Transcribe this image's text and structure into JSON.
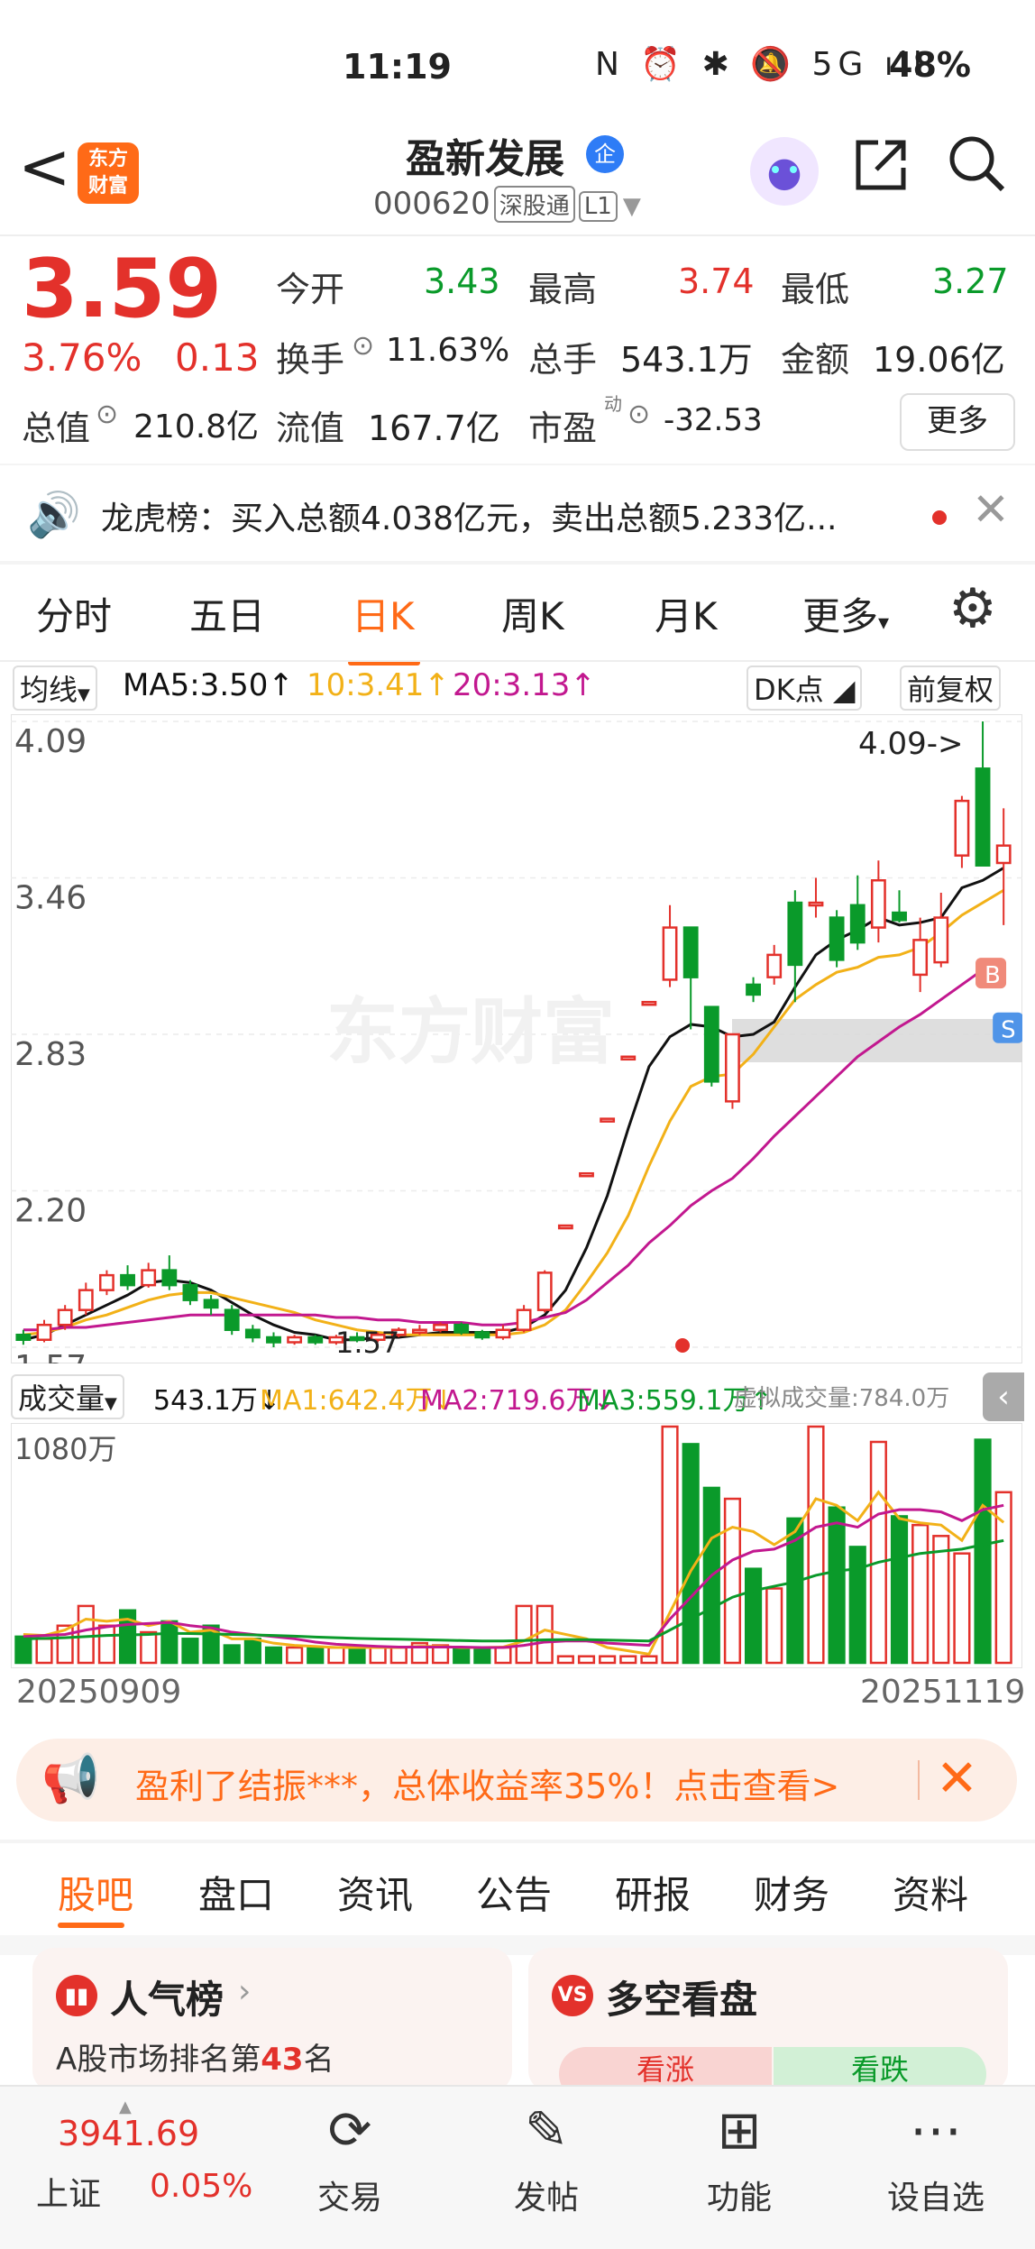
{
  "status_bar": {
    "time": "11:19",
    "icons": "N ⏰ ✱ 🔕 5G ıll",
    "battery": "48%"
  },
  "header": {
    "back": "<",
    "logo_line1": "东方",
    "logo_line2": "财富",
    "title": "盈新发展",
    "badge": "企",
    "code": "000620",
    "tag1": "深股通",
    "tag2": "L1"
  },
  "quote": {
    "price": "3.59",
    "change_pct": "3.76%",
    "change": "0.13",
    "open_label": "今开",
    "open": "3.43",
    "high_label": "最高",
    "high": "3.74",
    "low_label": "最低",
    "low": "3.27",
    "turnover_label": "换手",
    "turnover": "11.63%",
    "volume_label": "总手",
    "volume": "543.1万",
    "amount_label": "金额",
    "amount": "19.06亿",
    "mktcap_label": "总值",
    "mktcap": "210.8亿",
    "float_label": "流值",
    "float": "167.7亿",
    "pe_label": "市盈",
    "pe_sup": "动",
    "pe": "-32.53",
    "more": "更多"
  },
  "news": {
    "text": "龙虎榜：买入总额4.038亿元，卖出总额5.233亿..."
  },
  "tabs": [
    "分时",
    "五日",
    "日K",
    "周K",
    "月K",
    "更多"
  ],
  "tabs_more_arrow": "▾",
  "chart_header": {
    "ma_select": "均线",
    "ma5": "MA5:3.50↑",
    "ma10": "10:3.41↑",
    "ma20": "20:3.13↑",
    "dk": "DK点",
    "fq": "前复权"
  },
  "vol_header": {
    "select": "成交量",
    "vol": "543.1万↓",
    "ma1": "MA1:642.4万↓",
    "ma2": "MA2:719.6万↓",
    "ma3": "MA3:559.1万↑",
    "virtual": "虚拟成交量:784.0万"
  },
  "chart_labels": {
    "y1": "4.09",
    "y2": "3.46",
    "y3": "2.83",
    "y4": "2.20",
    "y5": "1.57",
    "max_label": "4.09->",
    "min_label": "1.57",
    "vol_max": "1080万",
    "date_start": "20250909",
    "date_end": "20251119",
    "watermark": "东方财富",
    "b": "B",
    "s": "S"
  },
  "chart_data": {
    "type": "candlestick",
    "ylim": [
      1.57,
      4.09
    ],
    "candles": [
      [
        1.62,
        1.6,
        1.64,
        1.58
      ],
      [
        1.6,
        1.66,
        1.68,
        1.59
      ],
      [
        1.66,
        1.72,
        1.74,
        1.64
      ],
      [
        1.72,
        1.8,
        1.83,
        1.7
      ],
      [
        1.8,
        1.86,
        1.88,
        1.78
      ],
      [
        1.86,
        1.82,
        1.9,
        1.8
      ],
      [
        1.82,
        1.88,
        1.91,
        1.81
      ],
      [
        1.88,
        1.82,
        1.94,
        1.8
      ],
      [
        1.82,
        1.76,
        1.84,
        1.74
      ],
      [
        1.76,
        1.73,
        1.78,
        1.7
      ],
      [
        1.72,
        1.64,
        1.74,
        1.62
      ],
      [
        1.64,
        1.61,
        1.66,
        1.59
      ],
      [
        1.61,
        1.59,
        1.63,
        1.57
      ],
      [
        1.59,
        1.61,
        1.62,
        1.58
      ],
      [
        1.61,
        1.59,
        1.62,
        1.58
      ],
      [
        1.59,
        1.61,
        1.62,
        1.58
      ],
      [
        1.61,
        1.6,
        1.63,
        1.59
      ],
      [
        1.6,
        1.62,
        1.63,
        1.59
      ],
      [
        1.62,
        1.64,
        1.65,
        1.61
      ],
      [
        1.64,
        1.64,
        1.66,
        1.62
      ],
      [
        1.64,
        1.66,
        1.67,
        1.63
      ],
      [
        1.66,
        1.63,
        1.67,
        1.62
      ],
      [
        1.63,
        1.61,
        1.64,
        1.6
      ],
      [
        1.61,
        1.64,
        1.66,
        1.6
      ],
      [
        1.64,
        1.72,
        1.74,
        1.63
      ],
      [
        1.72,
        1.87,
        1.88,
        1.71
      ],
      [
        2.06,
        2.06,
        2.06,
        2.06
      ],
      [
        2.27,
        2.27,
        2.27,
        2.27
      ],
      [
        2.49,
        2.49,
        2.49,
        2.49
      ],
      [
        2.74,
        2.74,
        2.74,
        2.74
      ],
      [
        2.96,
        2.96,
        2.96,
        2.96
      ],
      [
        3.05,
        3.26,
        3.35,
        3.02
      ],
      [
        3.26,
        3.06,
        3.21,
        2.85
      ],
      [
        2.94,
        2.64,
        2.9,
        2.62
      ],
      [
        2.56,
        2.83,
        2.83,
        2.53
      ],
      [
        3.03,
        2.99,
        3.06,
        2.96
      ],
      [
        3.06,
        3.15,
        3.19,
        3.03
      ],
      [
        3.36,
        3.11,
        3.41,
        2.96
      ],
      [
        3.36,
        3.36,
        3.46,
        3.3
      ],
      [
        3.3,
        3.13,
        3.33,
        3.1
      ],
      [
        3.35,
        3.2,
        3.47,
        3.17
      ],
      [
        3.26,
        3.45,
        3.53,
        3.2
      ],
      [
        3.32,
        3.29,
        3.41,
        3.28
      ],
      [
        3.07,
        3.21,
        3.3,
        3.0
      ],
      [
        3.12,
        3.3,
        3.4,
        3.1
      ],
      [
        3.55,
        3.77,
        3.79,
        3.5
      ],
      [
        3.9,
        3.51,
        4.09,
        3.52
      ],
      [
        3.52,
        3.59,
        3.74,
        3.27
      ]
    ],
    "ma5": [
      1.6,
      1.62,
      1.66,
      1.7,
      1.74,
      1.78,
      1.83,
      1.84,
      1.83,
      1.8,
      1.75,
      1.7,
      1.66,
      1.63,
      1.62,
      1.6,
      1.6,
      1.61,
      1.61,
      1.62,
      1.63,
      1.63,
      1.63,
      1.63,
      1.65,
      1.7,
      1.8,
      1.97,
      2.18,
      2.45,
      2.7,
      2.82,
      2.87,
      2.86,
      2.82,
      2.83,
      2.88,
      3.02,
      3.15,
      3.21,
      3.25,
      3.3,
      3.27,
      3.28,
      3.3,
      3.42,
      3.45,
      3.5
    ],
    "ma10": [
      1.62,
      1.63,
      1.65,
      1.68,
      1.7,
      1.73,
      1.76,
      1.78,
      1.79,
      1.79,
      1.77,
      1.75,
      1.73,
      1.71,
      1.68,
      1.66,
      1.64,
      1.63,
      1.62,
      1.62,
      1.62,
      1.62,
      1.62,
      1.62,
      1.63,
      1.66,
      1.72,
      1.83,
      1.95,
      2.1,
      2.3,
      2.48,
      2.62,
      2.66,
      2.67,
      2.75,
      2.86,
      2.97,
      3.03,
      3.08,
      3.1,
      3.14,
      3.15,
      3.18,
      3.24,
      3.31,
      3.36,
      3.41
    ],
    "ma20": [
      1.64,
      1.64,
      1.65,
      1.65,
      1.66,
      1.67,
      1.68,
      1.69,
      1.7,
      1.7,
      1.7,
      1.7,
      1.7,
      1.7,
      1.7,
      1.69,
      1.69,
      1.68,
      1.68,
      1.67,
      1.67,
      1.67,
      1.66,
      1.66,
      1.67,
      1.69,
      1.71,
      1.76,
      1.83,
      1.9,
      1.99,
      2.06,
      2.14,
      2.2,
      2.25,
      2.33,
      2.42,
      2.5,
      2.58,
      2.66,
      2.74,
      2.8,
      2.86,
      2.91,
      2.97,
      3.03,
      3.09,
      3.13
    ],
    "volume": [
      120,
      110,
      170,
      260,
      170,
      240,
      140,
      190,
      110,
      170,
      80,
      110,
      70,
      70,
      70,
      70,
      70,
      70,
      70,
      90,
      80,
      70,
      60,
      70,
      260,
      260,
      30,
      30,
      30,
      30,
      30,
      1080,
      1000,
      800,
      750,
      430,
      340,
      660,
      1080,
      710,
      530,
      1010,
      670,
      630,
      580,
      500,
      1020,
      780
    ],
    "vol_ma1": [
      130,
      125,
      150,
      200,
      190,
      200,
      170,
      190,
      140,
      150,
      110,
      110,
      90,
      80,
      75,
      70,
      70,
      70,
      70,
      75,
      75,
      70,
      70,
      72,
      100,
      150,
      130,
      110,
      70,
      55,
      40,
      230,
      420,
      570,
      620,
      600,
      540,
      600,
      750,
      720,
      650,
      780,
      660,
      640,
      630,
      560,
      720,
      642
    ],
    "vol_ma2": [
      120,
      125,
      130,
      150,
      165,
      175,
      180,
      185,
      170,
      160,
      140,
      130,
      120,
      110,
      95,
      85,
      80,
      75,
      72,
      72,
      72,
      72,
      70,
      70,
      80,
      95,
      100,
      100,
      90,
      85,
      80,
      200,
      300,
      400,
      470,
      510,
      520,
      560,
      620,
      640,
      620,
      680,
      700,
      700,
      690,
      650,
      700,
      720
    ],
    "vol_ma3": [
      110,
      112,
      115,
      120,
      125,
      128,
      130,
      135,
      134,
      132,
      130,
      128,
      125,
      122,
      118,
      115,
      112,
      110,
      108,
      106,
      104,
      102,
      100,
      100,
      102,
      105,
      106,
      106,
      104,
      102,
      100,
      150,
      200,
      250,
      300,
      330,
      350,
      370,
      400,
      420,
      430,
      460,
      480,
      500,
      510,
      520,
      540,
      559
    ]
  },
  "banner": {
    "text": "盈利了结振***，总体收益率35%！点击查看>"
  },
  "lower_tabs": [
    "股吧",
    "盘口",
    "资讯",
    "公告",
    "研报",
    "财务",
    "资料"
  ],
  "cards": {
    "popularity_title": "人气榜",
    "popularity_sub_pre": "A股市场排名第",
    "popularity_rank": "43",
    "popularity_sub_post": "名",
    "bullbear_title": "多空看盘",
    "bull": "看涨",
    "bear": "看跌"
  },
  "bottom": {
    "index_value": "3941.69",
    "index_name": "上证",
    "index_change": "0.05%",
    "trade": "交易",
    "post": "发帖",
    "func": "功能",
    "watch": "设自选"
  },
  "colors": {
    "up": "#e3312b",
    "down": "#0a9a2a",
    "accent": "#ff6a17",
    "ma5": "#111111",
    "ma10": "#f2b118",
    "ma20": "#c2188f"
  }
}
